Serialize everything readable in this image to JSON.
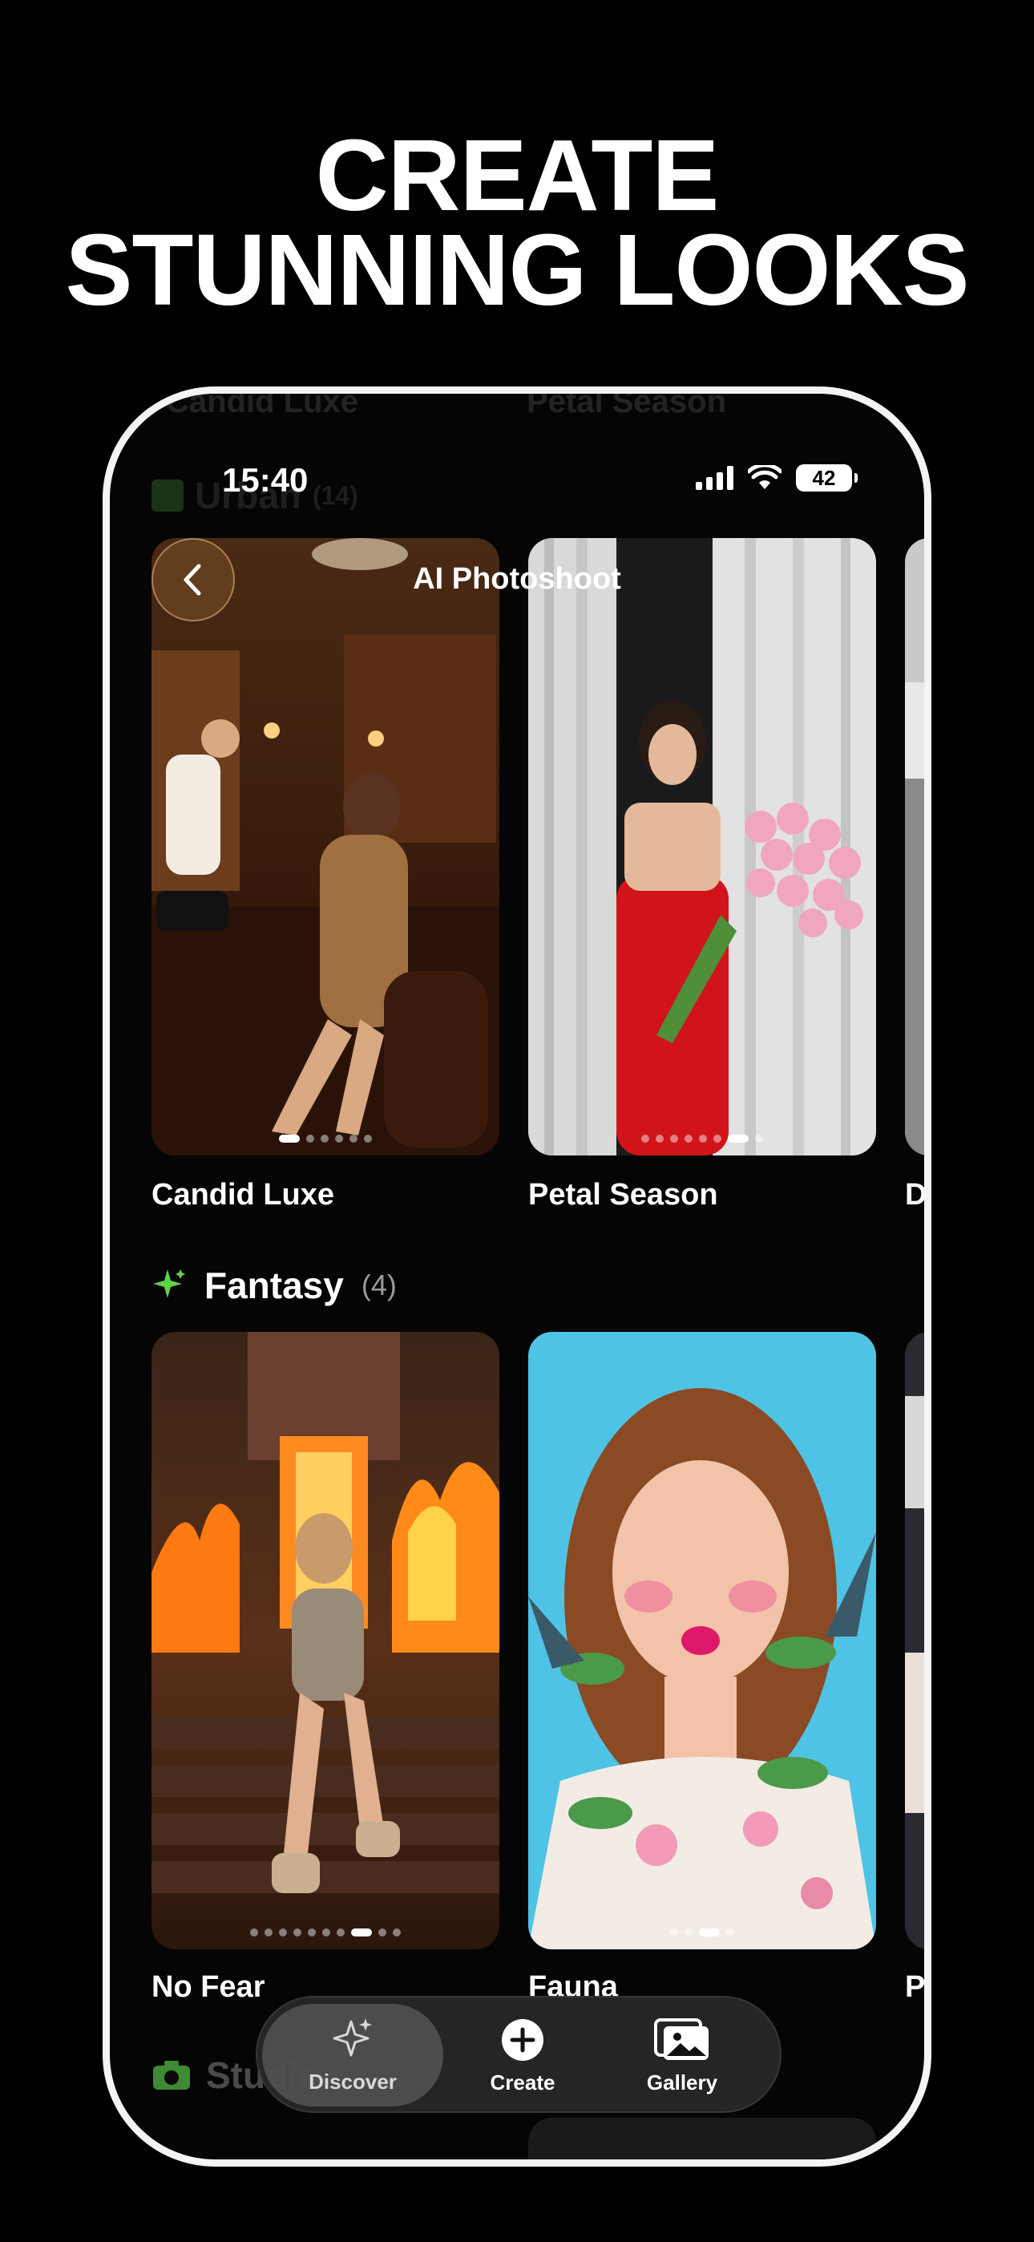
{
  "headline": {
    "line1": "CREATE",
    "line2": "STUNNING LOOKS"
  },
  "status_bar": {
    "time": "15:40",
    "battery": "42"
  },
  "ghost": {
    "top_left": "Candid Luxe",
    "top_right": "Petal Season",
    "category": "Urban",
    "category_count": "(14)",
    "bottom_category": "Studio"
  },
  "nav": {
    "title": "AI Photoshoot",
    "back_icon": "chevron-left-icon"
  },
  "row1": {
    "cards": [
      {
        "label": "Candid Luxe",
        "dots": 6,
        "active_dot": 0
      },
      {
        "label": "Petal Season",
        "dots": 8,
        "active_dot": 6
      },
      {
        "label": "D"
      }
    ]
  },
  "section": {
    "title": "Fantasy",
    "count": "(4)",
    "icon": "sparkle-icon",
    "icon_color": "#5fd24a"
  },
  "row2": {
    "cards": [
      {
        "label": "No Fear",
        "dots": 10,
        "active_dot": 7
      },
      {
        "label": "Fauna",
        "dots": 4,
        "active_dot": 2
      },
      {
        "label": "P"
      }
    ]
  },
  "tabbar": {
    "tabs": [
      {
        "label": "Discover",
        "icon": "sparkles-icon",
        "active": true
      },
      {
        "label": "Create",
        "icon": "plus-circle-icon",
        "active": false
      },
      {
        "label": "Gallery",
        "icon": "gallery-icon",
        "active": false
      }
    ]
  }
}
